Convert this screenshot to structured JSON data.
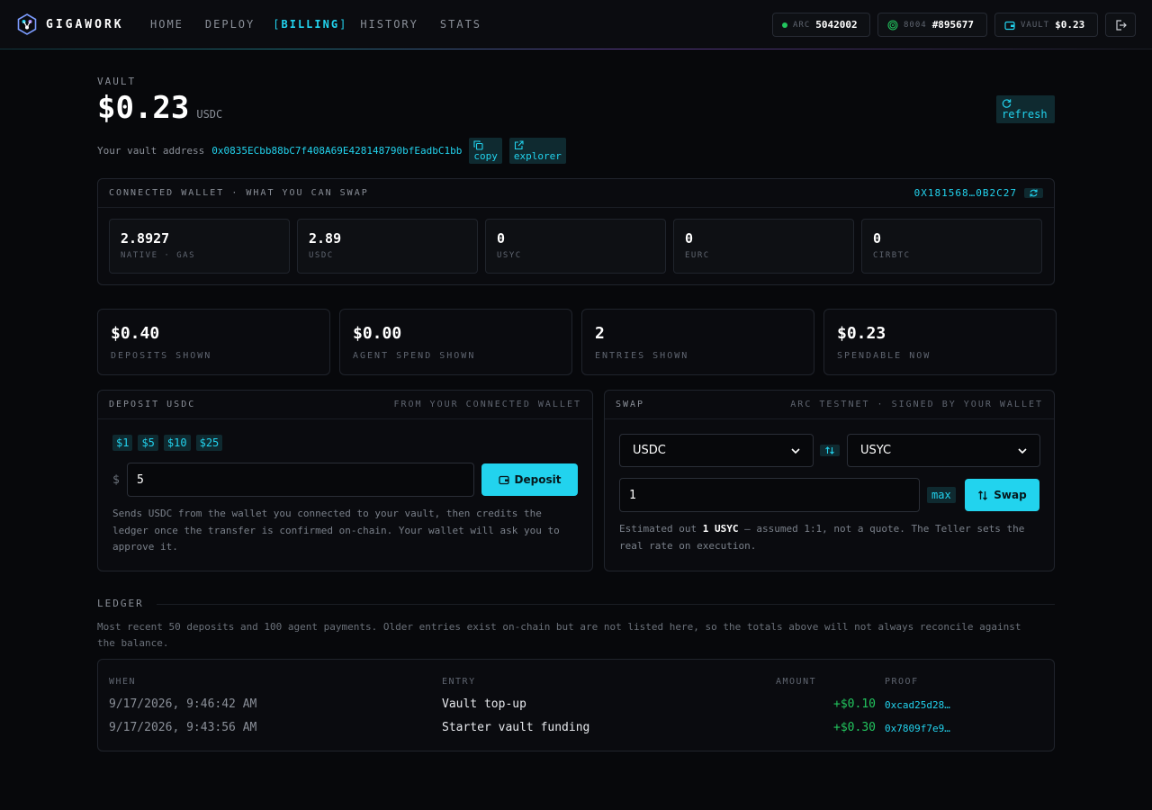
{
  "nav": {
    "brand": "GIGAWORK",
    "links": [
      {
        "label": "HOME"
      },
      {
        "label": "DEPLOY"
      },
      {
        "label": "BILLING",
        "bracket_open": "[",
        "bracket_close": "]"
      },
      {
        "label": "HISTORY"
      },
      {
        "label": "STATS"
      }
    ],
    "arc": {
      "label": "ARC",
      "value": "5042002"
    },
    "agent": {
      "label": "8004",
      "value": "#895677"
    },
    "vault": {
      "label": "VAULT",
      "value": "$0.23"
    }
  },
  "vault": {
    "label": "VAULT",
    "amount": "$0.23",
    "currency": "USDC",
    "refresh_label": "refresh",
    "address_label": "Your vault address",
    "address": "0x0835ECbb88bC7f408A69E428148790bfEadbC1bb",
    "copy_label": "copy",
    "explorer_label": "explorer"
  },
  "wallet": {
    "title": "CONNECTED WALLET · WHAT YOU CAN SWAP",
    "address": "0X181568…0B2C27",
    "balances": [
      {
        "value": "2.8927",
        "label": "NATIVE · GAS"
      },
      {
        "value": "2.89",
        "label": "USDC"
      },
      {
        "value": "0",
        "label": "USYC"
      },
      {
        "value": "0",
        "label": "EURC"
      },
      {
        "value": "0",
        "label": "CIRBTC"
      }
    ]
  },
  "stats": [
    {
      "value": "$0.40",
      "label": "DEPOSITS SHOWN"
    },
    {
      "value": "$0.00",
      "label": "AGENT SPEND SHOWN"
    },
    {
      "value": "2",
      "label": "ENTRIES SHOWN"
    },
    {
      "value": "$0.23",
      "label": "SPENDABLE NOW"
    }
  ],
  "deposit": {
    "title": "DEPOSIT USDC",
    "subtitle": "FROM YOUR CONNECTED WALLET",
    "quick_amounts": [
      "$1",
      "$5",
      "$10",
      "$25"
    ],
    "currency_symbol": "$",
    "amount": "5",
    "button_label": "Deposit",
    "help": "Sends USDC from the wallet you connected to your vault, then credits the ledger once the transfer is confirmed on-chain. Your wallet will ask you to approve it."
  },
  "swap": {
    "title": "SWAP",
    "subtitle": "ARC TESTNET · SIGNED BY YOUR WALLET",
    "from_token": "USDC",
    "to_token": "USYC",
    "amount": "1",
    "max_label": "max",
    "button_label": "Swap",
    "help_prefix": "Estimated out ",
    "help_value": "1 USYC",
    "help_suffix": " — assumed 1:1, not a quote. The Teller sets the real rate on execution."
  },
  "ledger": {
    "title": "LEDGER",
    "note": "Most recent 50 deposits and 100 agent payments. Older entries exist on-chain but are not listed here, so the totals above will not always reconcile against the balance.",
    "columns": {
      "when": "WHEN",
      "entry": "ENTRY",
      "amount": "AMOUNT",
      "proof": "PROOF"
    },
    "rows": [
      {
        "when": "9/17/2026, 9:46:42 AM",
        "entry": "Vault top-up",
        "amount": "+$0.10",
        "proof": "0xcad25d28…"
      },
      {
        "when": "9/17/2026, 9:43:56 AM",
        "entry": "Starter vault funding",
        "amount": "+$0.30",
        "proof": "0x7809f7e9…"
      }
    ]
  },
  "colors": {
    "accent": "#22d3ee",
    "positive": "#22c55e",
    "background": "#07080b"
  }
}
